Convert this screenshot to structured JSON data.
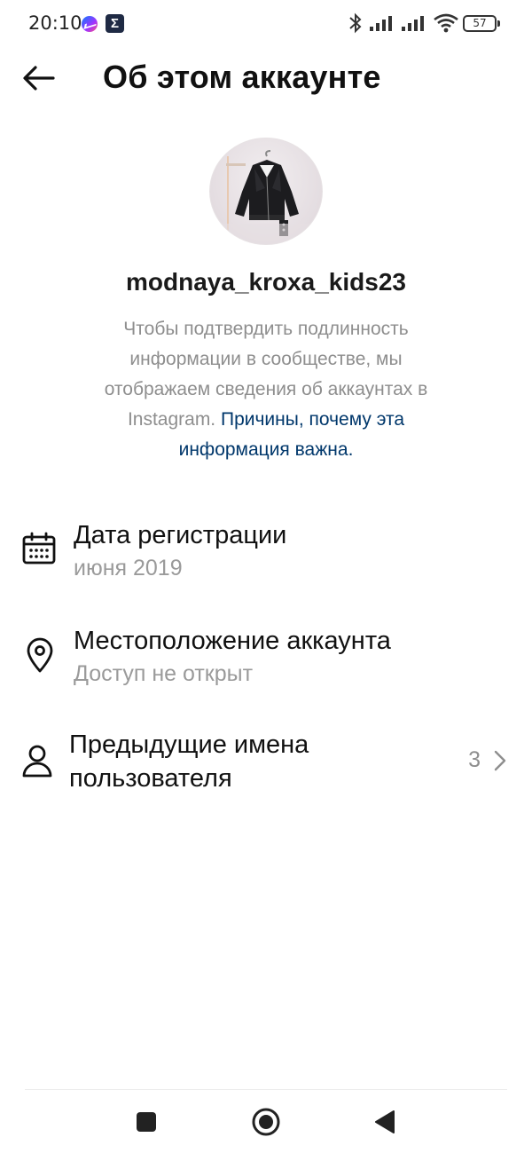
{
  "status_bar": {
    "time": "20:10",
    "battery": "57",
    "icons": [
      "messenger-icon",
      "sigma-icon",
      "bluetooth-icon",
      "signal-icon",
      "signal-icon",
      "wifi-icon",
      "battery-icon"
    ]
  },
  "header": {
    "title": "Об этом аккаунте",
    "back_icon": "arrow-left-icon"
  },
  "profile": {
    "username": "modnaya_kroxa_kids23",
    "avatar": "avatar-photo-leather-jacket"
  },
  "info": {
    "text": "Чтобы подтвердить подлинность информации в сообществе, мы отображаем сведения об аккаунтах в Instagram. ",
    "link": "Причины, почему эта информация важна",
    "period": "."
  },
  "rows": [
    {
      "icon": "calendar-icon",
      "title": "Дата регистрации",
      "subtitle": "июня 2019"
    },
    {
      "icon": "location-pin-icon",
      "title": "Местоположение аккаунта",
      "subtitle": "Доступ не открыт"
    },
    {
      "icon": "person-icon",
      "title_line1": "Предыдущие имена",
      "title_line2": "пользователя",
      "count": "3",
      "chevron": "chevron-right-icon"
    }
  ],
  "nav": {
    "icons": [
      "square-recents-icon",
      "circle-home-icon",
      "triangle-back-icon"
    ]
  },
  "colors": {
    "link": "#00376b",
    "secondary_text": "#8e8e8e",
    "primary_text": "#111111"
  }
}
